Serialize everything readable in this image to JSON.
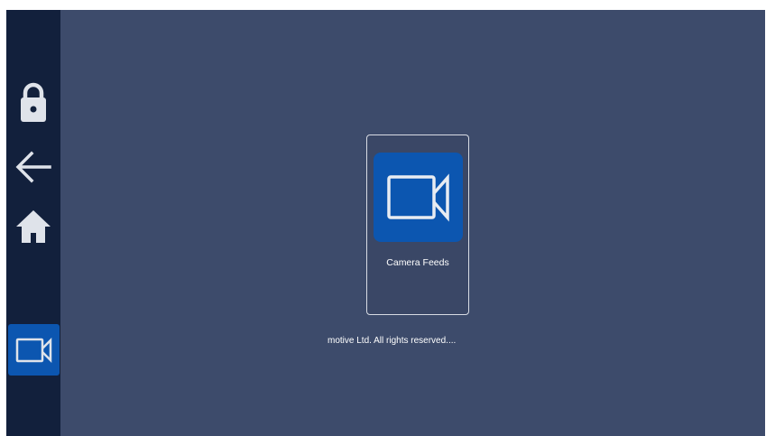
{
  "sidebar": {
    "items": [
      {
        "icon": "lock-icon"
      },
      {
        "icon": "arrow-left-icon"
      },
      {
        "icon": "home-icon"
      },
      {
        "icon": "video-camera-icon",
        "active": true
      }
    ]
  },
  "main": {
    "tiles": [
      {
        "label": "Camera Feeds",
        "icon": "video-camera-icon"
      }
    ]
  },
  "footer": {
    "text": "motive Ltd. All rights reserved...."
  },
  "colors": {
    "background": "#3d4b6b",
    "sidebar": "#12203c",
    "accent": "#0c56b0",
    "icon": "#dfe3ea"
  }
}
